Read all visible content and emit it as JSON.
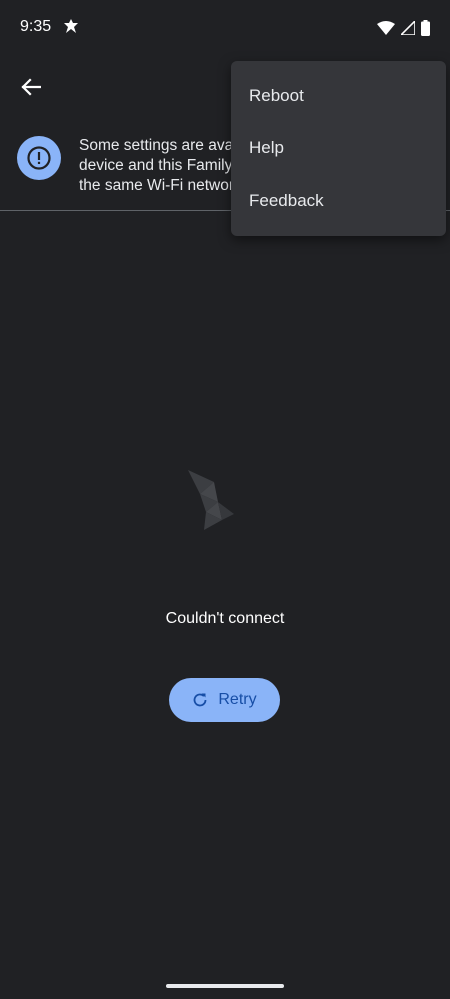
{
  "status_bar": {
    "time": "9:35",
    "icons": [
      "notification-icon",
      "wifi-icon",
      "signal-icon",
      "battery-icon"
    ]
  },
  "toolbar": {
    "back_icon": "arrow-back-icon"
  },
  "banner": {
    "icon": "alert-icon",
    "text": "Some settings are ava\ndevice and this Family\nthe same Wi-Fi networ"
  },
  "menu": {
    "items": [
      {
        "label": "Reboot"
      },
      {
        "label": "Help"
      },
      {
        "label": "Feedback"
      }
    ]
  },
  "main": {
    "error_text": "Couldn't connect",
    "retry_label": "Retry",
    "retry_icon": "refresh-icon"
  },
  "colors": {
    "background": "#202124",
    "accent": "#8ab4f8",
    "menu_bg": "#35363a"
  }
}
